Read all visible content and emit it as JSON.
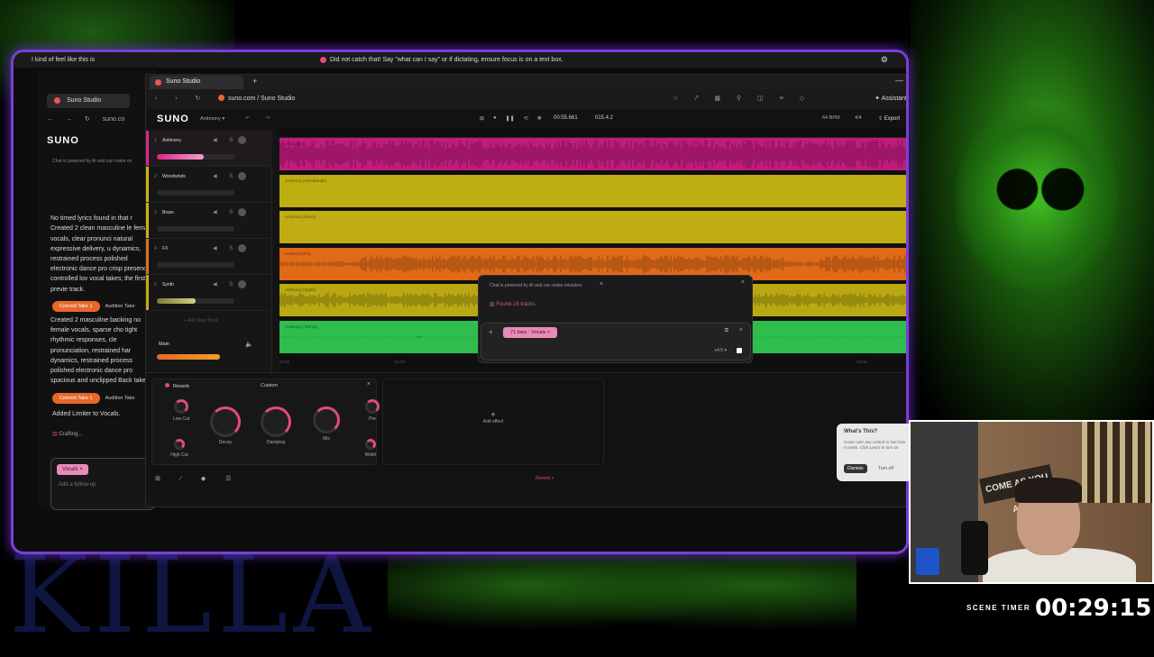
{
  "dictation": {
    "left_text": "I kind of feel like this is",
    "message": "Did not catch that! Say \"what can I say\" or if dictating, ensure focus is on a text box."
  },
  "back_window": {
    "tab_title": "Suno Studio",
    "url_partial": "suno.co",
    "logo": "SUNO",
    "disclaimer": "Chat is powered by AI and can make mi",
    "extra_label": "Ev",
    "chat_text": "No timed lyrics found in that r\nCreated 2 clean masculine le female vocals, clear pronunci natural expressive delivery, u dynamics, restrained process polished electronic dance pro crisp presence, controlled lov vocal takes; the first is previe track.",
    "chat_text_2": "Created 2 masculine backing no female vocals, sparse cho tight rhythmic responses, cle pronunciation, restrained har dynamics, restrained process polished electronic dance pro spacious and unclipped Back takes; the first is previewing c",
    "commit_label": "Commit Take 1",
    "audition_label": "Audition Take",
    "limiter_text": "Added Limiter to Vocals.",
    "crafting": "Crafting...",
    "chip": "Vocals",
    "followup_placeholder": "Add a follow-up"
  },
  "browser": {
    "tab_title": "Suno Studio",
    "url": "suno.com / Suno Studio",
    "assistant": "Assistant"
  },
  "app": {
    "logo": "SUNO",
    "project": "Antimony",
    "time": "00:55.661",
    "bar": "015.4.2",
    "bpm": "64 BPM",
    "time_sig": "4/4",
    "export": "Export"
  },
  "tracks": [
    {
      "num": "1",
      "name": "Antimony",
      "color": "#d6288a",
      "lane_label": "Antimony",
      "lane_color": "#c01c7c"
    },
    {
      "num": "2",
      "name": "Woodwinds",
      "color": "#c8b414",
      "lane_label": "Antimony (Woodwinds)",
      "lane_color": "#bfae12"
    },
    {
      "num": "3",
      "name": "Brass",
      "color": "#c8b414",
      "lane_label": "Antimony (Brass)",
      "lane_color": "#c0ad14"
    },
    {
      "num": "4",
      "name": "FX",
      "color": "#e3701c",
      "lane_label": "Antimony (FX)",
      "lane_color": "#e06a18"
    },
    {
      "num": "5",
      "name": "Synth",
      "color": "#bfae12",
      "lane_label": "Antimony (Synth)",
      "lane_color": "#b9a812"
    },
    {
      "num": "6",
      "name": "",
      "color": "#2fb84a",
      "lane_label": "Antimony (Strings)",
      "lane_color": "#2fbd4e"
    }
  ],
  "add_track": "Add New Track",
  "main_label": "Main",
  "timeline_marks": [
    "00:00",
    "01:00",
    "02:00",
    "03:00",
    "04:00",
    "05:00"
  ],
  "overlay_chat": {
    "disclaimer": "Chat is powered by AI and can make mistakes",
    "found": "Found 16 tracks.",
    "chip": "71 bars · Vocals",
    "version": "v4.5 ▾"
  },
  "effect": {
    "title": "Reverb",
    "preset": "Custom",
    "knobs": [
      {
        "label": "Low Cut"
      },
      {
        "label": "Decay"
      },
      {
        "label": "Damping"
      },
      {
        "label": "Mix"
      },
      {
        "label": "Pre"
      },
      {
        "label": "High Cut"
      },
      {
        "label": "Width"
      }
    ],
    "add_effect": "Add effect",
    "bottom_label": "Reverb"
  },
  "whats_this": {
    "title": "What's This?",
    "body": "Hover over any control to see how it works. Click Learn to turn on",
    "dismiss": "Dismiss",
    "turn_off": "Turn off"
  },
  "stream": {
    "scene_label": "SCENE TIMER",
    "scene_time": "00:29:15",
    "killa": "KILLA",
    "cam_sign": "COME AS YOU ARE"
  },
  "colors": {
    "frame": "#7a3fd6",
    "accent_pink": "#e14b7d",
    "accent_orange": "#e8682a"
  }
}
